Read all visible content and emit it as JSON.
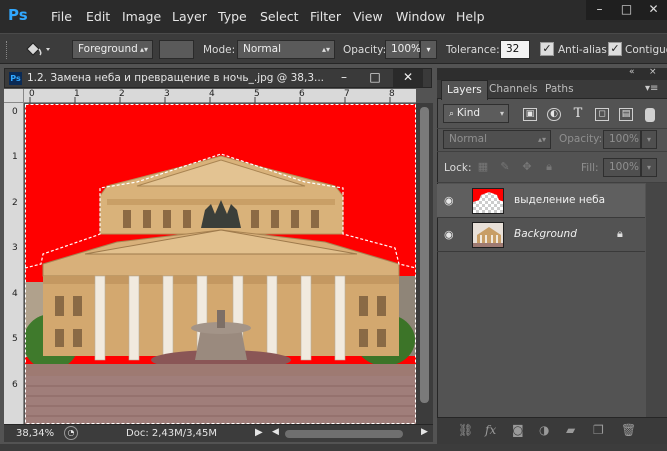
{
  "app": {
    "logo": "Ps"
  },
  "menu": [
    "File",
    "Edit",
    "Image",
    "Layer",
    "Type",
    "Select",
    "Filter",
    "View",
    "Window",
    "Help"
  ],
  "window_controls": {
    "minimize": "–",
    "restore": "□",
    "close": "✕"
  },
  "options_bar": {
    "tool_icon": "paint-bucket-icon",
    "fill_source": "Foreground",
    "mode_label": "Mode:",
    "mode_value": "Normal",
    "opacity_label": "Opacity:",
    "opacity_value": "100%",
    "tolerance_label": "Tolerance:",
    "tolerance_value": "32",
    "antialias_label": "Anti-alias",
    "antialias_checked": true,
    "contiguous_label": "Contiguo",
    "contiguous_checked": true
  },
  "document": {
    "title": "1.2. Замена неба и превращение в ночь_.jpg @ 38,3...",
    "ruler_h_ticks": [
      "0",
      "1",
      "2",
      "3",
      "4",
      "5",
      "6",
      "7",
      "8"
    ],
    "ruler_v_ticks": [
      "0",
      "1",
      "2",
      "3",
      "4",
      "5",
      "6"
    ],
    "zoom": "38,34%",
    "doc_size": "Doc: 2,43M/3,45M",
    "colors": {
      "sky": "#ff0000"
    }
  },
  "layers_panel": {
    "tabs": [
      "Layers",
      "Channels",
      "Paths"
    ],
    "active_tab": "Layers",
    "filter_kind": "Kind",
    "filter_icons": [
      "image-filter-icon",
      "adjustment-filter-icon",
      "type-filter-icon",
      "shape-filter-icon",
      "smart-object-filter-icon"
    ],
    "blend_mode": "Normal",
    "opacity_label": "Opacity:",
    "opacity_value": "100%",
    "lock_label": "Lock:",
    "fill_label": "Fill:",
    "fill_value": "100%",
    "layers": [
      {
        "name": "выделение неба",
        "selected": true,
        "italic": false,
        "locked": false
      },
      {
        "name": "Background",
        "selected": false,
        "italic": true,
        "locked": true
      }
    ],
    "footer_icons": [
      "link-icon",
      "fx-icon",
      "mask-icon",
      "adjustment-icon",
      "group-folder-icon",
      "new-layer-icon",
      "trash-icon"
    ]
  }
}
